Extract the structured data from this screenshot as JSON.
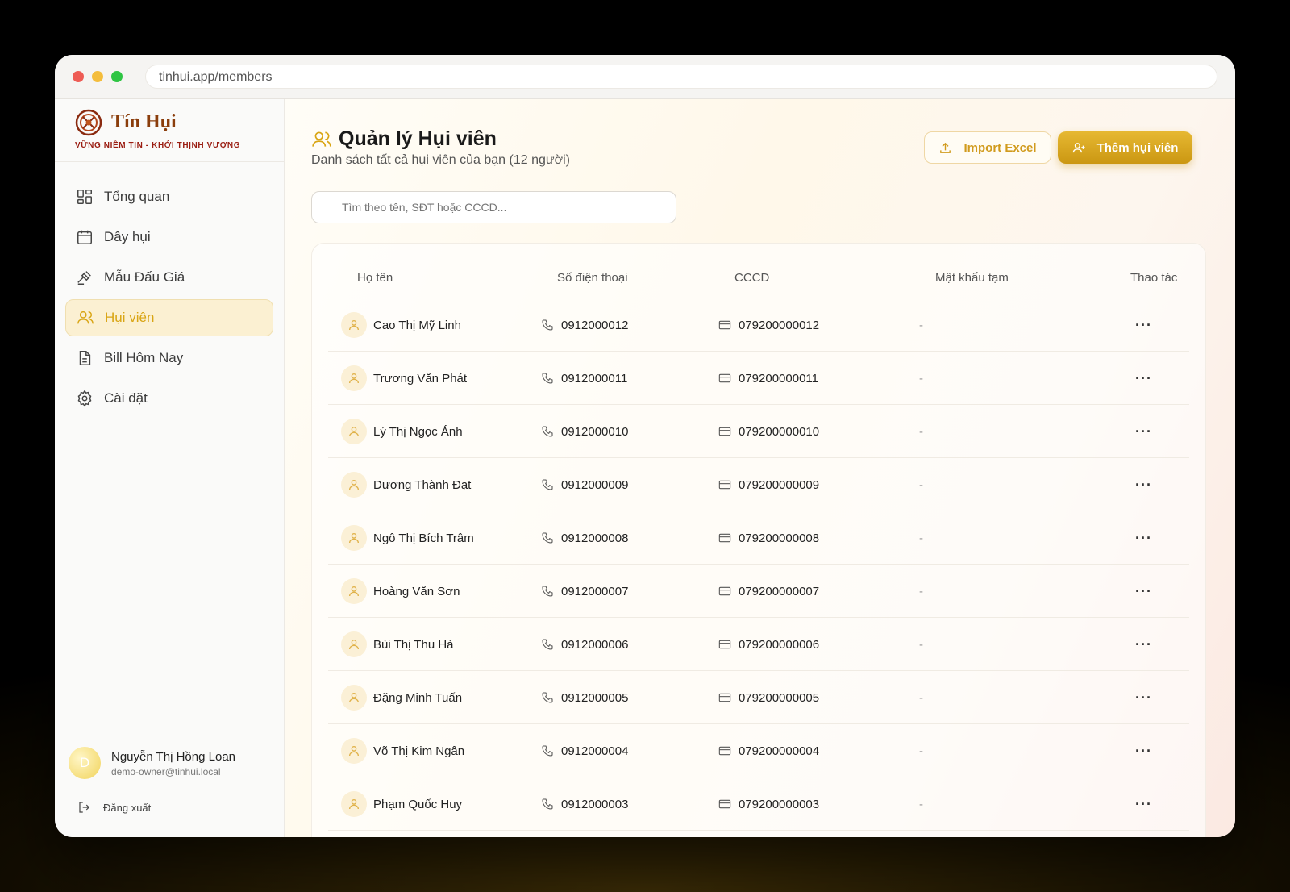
{
  "browser": {
    "url": "tinhui.app/members"
  },
  "brand": {
    "name": "Tín Hụi",
    "tagline": "VỮNG NIỀM TIN - KHỞI THỊNH VƯỢNG",
    "color": "#8a3d0c"
  },
  "sidebar": {
    "items": [
      {
        "label": "Tổng quan",
        "icon": "grid-icon"
      },
      {
        "label": "Dây hụi",
        "icon": "calendar-icon"
      },
      {
        "label": "Mẫu Đấu Giá",
        "icon": "gavel-icon"
      },
      {
        "label": "Hụi viên",
        "icon": "users-icon",
        "active": true
      },
      {
        "label": "Bill Hôm Nay",
        "icon": "document-icon"
      },
      {
        "label": "Cài đặt",
        "icon": "gear-icon"
      }
    ]
  },
  "user": {
    "initial": "D",
    "name": "Nguyễn Thị Hồng Loan",
    "email": "demo-owner@tinhui.local",
    "logout_label": "Đăng xuất"
  },
  "header": {
    "title": "Quản lý Hụi viên",
    "subtitle": "Danh sách tất cả hụi viên của bạn (12 người)",
    "import_label": "Import Excel",
    "add_label": "Thêm hụi viên"
  },
  "search": {
    "placeholder": "Tìm theo tên, SĐT hoặc CCCD..."
  },
  "table": {
    "columns": [
      "Họ tên",
      "Số điện thoại",
      "CCCD",
      "Mật khẩu tạm",
      "Thao tác"
    ],
    "rows": [
      {
        "name": "Cao Thị Mỹ Linh",
        "phone": "0912000012",
        "cccd": "079200000012",
        "password": "-",
        "action": "···"
      },
      {
        "name": "Trương Văn Phát",
        "phone": "0912000011",
        "cccd": "079200000011",
        "password": "-",
        "action": "···"
      },
      {
        "name": "Lý Thị Ngọc Ánh",
        "phone": "0912000010",
        "cccd": "079200000010",
        "password": "-",
        "action": "···"
      },
      {
        "name": "Dương Thành Đạt",
        "phone": "0912000009",
        "cccd": "079200000009",
        "password": "-",
        "action": "···"
      },
      {
        "name": "Ngô Thị Bích Trâm",
        "phone": "0912000008",
        "cccd": "079200000008",
        "password": "-",
        "action": "···"
      },
      {
        "name": "Hoàng Văn Sơn",
        "phone": "0912000007",
        "cccd": "079200000007",
        "password": "-",
        "action": "···"
      },
      {
        "name": "Bùi Thị Thu Hà",
        "phone": "0912000006",
        "cccd": "079200000006",
        "password": "-",
        "action": "···"
      },
      {
        "name": "Đặng Minh Tuấn",
        "phone": "0912000005",
        "cccd": "079200000005",
        "password": "-",
        "action": "···"
      },
      {
        "name": "Võ Thị Kim Ngân",
        "phone": "0912000004",
        "cccd": "079200000004",
        "password": "-",
        "action": "···"
      },
      {
        "name": "Phạm Quốc Huy",
        "phone": "0912000003",
        "cccd": "079200000003",
        "password": "-",
        "action": "···"
      }
    ]
  },
  "colors": {
    "accent": "#d9a514",
    "active_bg": "#fbf0d2"
  }
}
